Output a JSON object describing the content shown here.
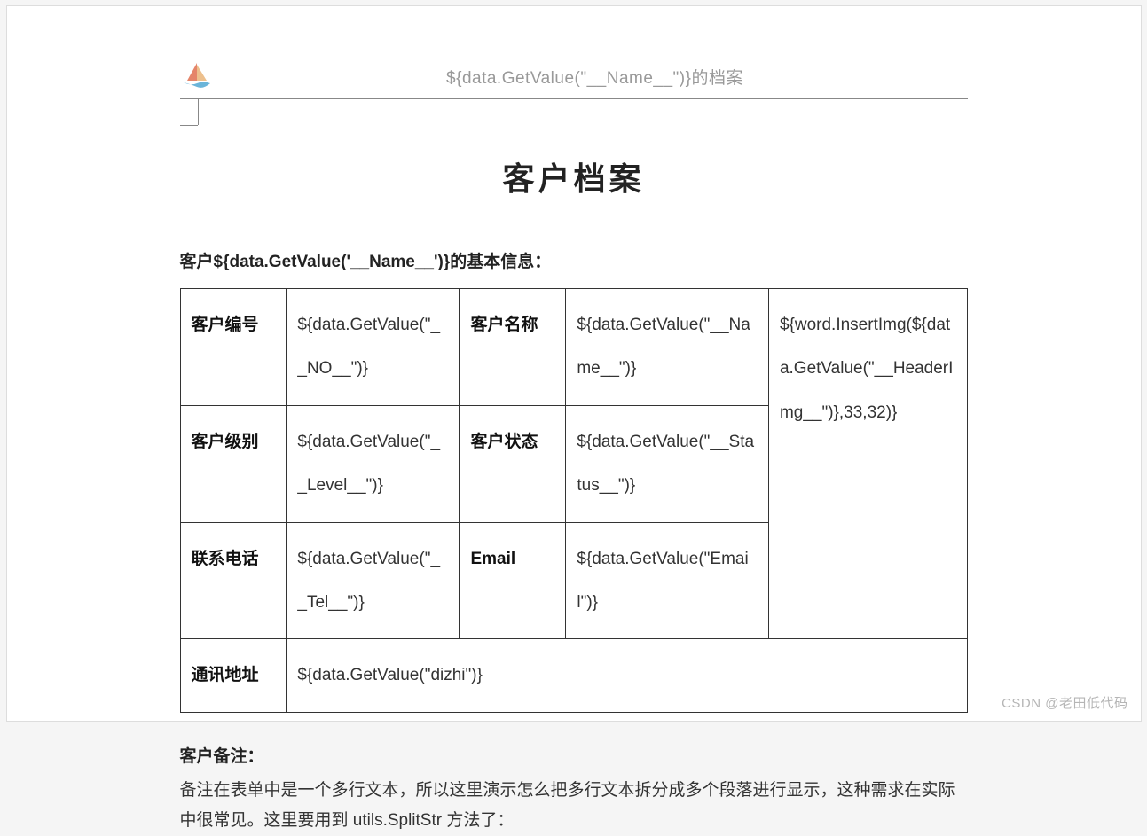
{
  "header": {
    "text": "${data.GetValue(\"__Name__\")}的档案"
  },
  "title": "客户档案",
  "subtitle": "客户${data.GetValue('__Name__')}的基本信息：",
  "table": {
    "row1": {
      "label1": "客户编号",
      "value1": "${data.GetValue(\"__NO__\")}",
      "label2": "客户名称",
      "value2": "${data.GetValue(\"__Name__\")}"
    },
    "row2": {
      "label1": "客户级别",
      "value1": "${data.GetValue(\"__Level__\")}",
      "label2": "客户状态",
      "value2": "${data.GetValue(\"__Status__\")}"
    },
    "row3": {
      "label1": "联系电话",
      "value1": "${data.GetValue(\"__Tel__\")}",
      "label2": "Email",
      "value2": "${data.GetValue(\"Email\")}"
    },
    "row4": {
      "label1": "通讯地址",
      "value1": "${data.GetValue(\"dizhi\")}"
    },
    "img_cell": "${word.InsertImg(${data.GetValue(\"__HeaderImg__\")},33,32)}"
  },
  "notes": {
    "title": "客户备注：",
    "body": "备注在表单中是一个多行文本，所以这里演示怎么把多行文本拆分成多个段落进行显示，这种需求在实际中很常见。这里要用到 utils.SplitStr 方法了："
  },
  "watermark": "CSDN @老田低代码"
}
